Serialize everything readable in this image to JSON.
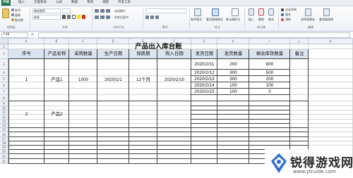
{
  "ribbon": {
    "tabs": [
      "开始",
      "插入",
      "页面布局",
      "公式",
      "数据",
      "审阅",
      "视图",
      "开发工具"
    ],
    "font_name": "微软雅黑",
    "font_name2": "宋体",
    "buttons": {
      "cut": "剪切",
      "copy": "复制",
      "format_painter": "格式刷",
      "wrap_text": "自动换行",
      "merge_center": "合并后居中",
      "conditional": "条件格式",
      "table_format": "套用表格格式",
      "cell_style": "单元格样式",
      "insert": "插入",
      "delete": "删除",
      "format": "格式",
      "autosum": "自动求和",
      "fill": "填充",
      "clear": "清除",
      "sort": "排序和筛选",
      "find": "查找和选择"
    },
    "groups": [
      "剪贴板",
      "字体",
      "对齐方式",
      "数字",
      "样式",
      "单元格",
      "编辑"
    ]
  },
  "formula_bar": {
    "name_box": "F26",
    "fx": "fx",
    "value": ""
  },
  "columns": [
    "A",
    "B",
    "C",
    "D",
    "E",
    "F",
    "G",
    "H",
    "I",
    "J",
    "K"
  ],
  "rows": [
    "1",
    "2",
    "3",
    "4",
    "5",
    "6",
    "7",
    "8",
    "9",
    "10",
    "11",
    "12",
    "13",
    "14",
    "15",
    "16",
    "17",
    "18",
    "19",
    "20",
    "21",
    "22"
  ],
  "sheet": {
    "title": "产品出入库台账",
    "headers": [
      "序号",
      "产品名称",
      "采购数量",
      "生产日期",
      "保质期",
      "购入日期",
      "发货日期",
      "发货数量",
      "剩余库存数量",
      "备注"
    ],
    "record1": {
      "seq": "1",
      "name": "产品1",
      "qty": "1000",
      "prod_date": "2020/1/1",
      "shelf": "12个月",
      "buy_date": "2020/2/10",
      "shipments": [
        {
          "date": "2020/2/11",
          "qty": "200",
          "remain": "800"
        },
        {
          "date": "2020/2/12",
          "qty": "300",
          "remain": "500"
        },
        {
          "date": "2020/2/13",
          "qty": "300",
          "remain": "200"
        },
        {
          "date": "2020/2/14",
          "qty": "100",
          "remain": "100"
        },
        {
          "date": "2020/2/15",
          "qty": "100",
          "remain": "0"
        }
      ]
    },
    "record2": {
      "seq": "2",
      "name": "产品2"
    }
  },
  "watermark": {
    "name": "锐得游戏网",
    "url": "www.ytruide.com"
  }
}
